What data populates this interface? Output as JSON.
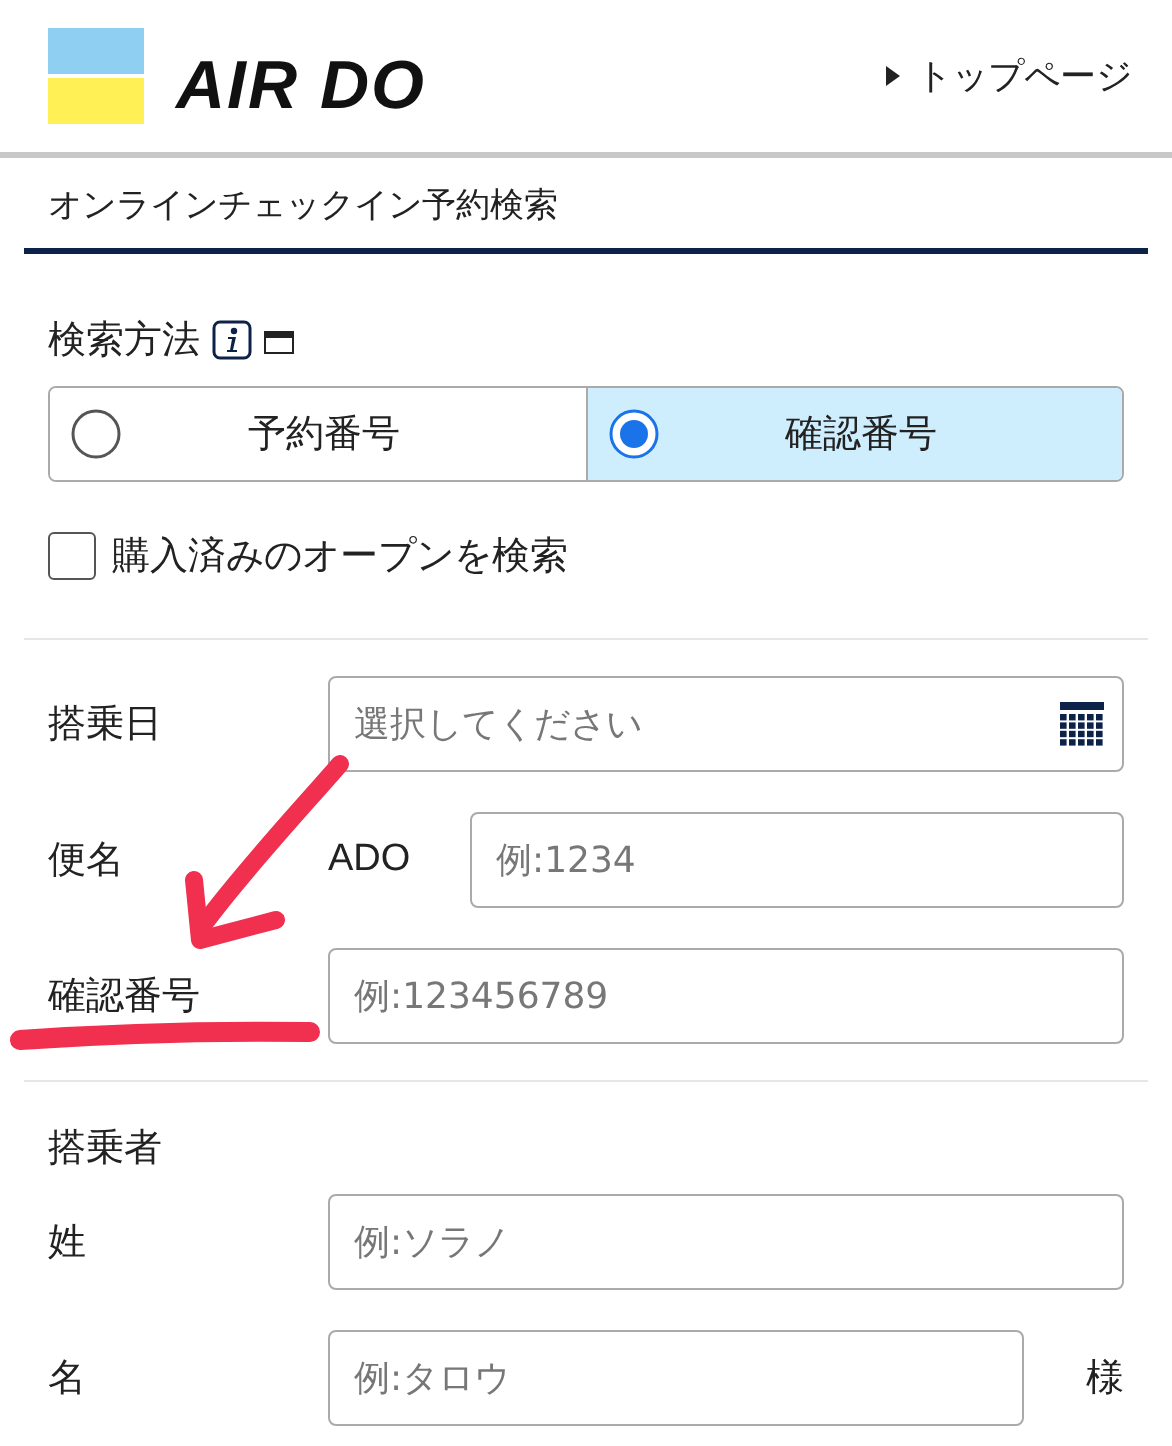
{
  "header": {
    "logo_text": "AIR DO",
    "top_link": "トップページ"
  },
  "page_title": "オンラインチェックイン予約検索",
  "search_method": {
    "label": "検索方法",
    "options": [
      {
        "label": "予約番号",
        "selected": false
      },
      {
        "label": "確認番号",
        "selected": true
      }
    ]
  },
  "open_search": {
    "label": "購入済みのオープンを検索",
    "checked": false
  },
  "fields": [
    {
      "kind": "date",
      "label": "搭乗日",
      "placeholder": "選択してください"
    },
    {
      "kind": "prefixed",
      "label": "便名",
      "prefix": "ADO",
      "placeholder": "例:1234"
    },
    {
      "kind": "text",
      "label": "確認番号",
      "placeholder": "例:123456789"
    }
  ],
  "passenger": {
    "heading": "搭乗者",
    "fields": [
      {
        "kind": "text",
        "label": "姓",
        "placeholder": "例:ソラノ"
      },
      {
        "kind": "suffixed",
        "label": "名",
        "placeholder": "例:タロウ",
        "suffix": "様"
      }
    ]
  }
}
